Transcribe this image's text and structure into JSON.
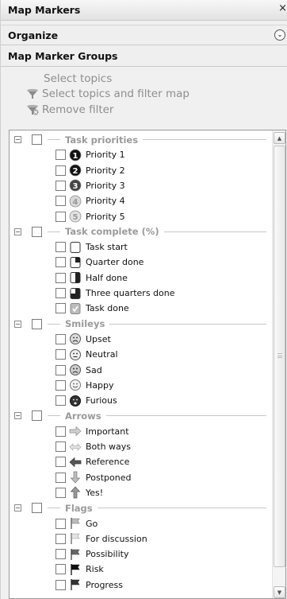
{
  "header": {
    "title": "Map Markers",
    "close_glyph": "×"
  },
  "organize": {
    "label": "Organize",
    "chevron_glyph": "⌄"
  },
  "groups_header": {
    "label": "Map Marker Groups"
  },
  "actions": {
    "select_topics": "Select topics",
    "select_and_filter": "Select topics and filter map",
    "remove_filter": "Remove filter"
  },
  "groups": [
    {
      "label": "Task priorities",
      "items": [
        {
          "label": "Priority 1",
          "icon": "priority-1",
          "glyph": "1"
        },
        {
          "label": "Priority 2",
          "icon": "priority-2",
          "glyph": "2"
        },
        {
          "label": "Priority 3",
          "icon": "priority-3",
          "glyph": "3"
        },
        {
          "label": "Priority 4",
          "icon": "priority-4",
          "glyph": "4"
        },
        {
          "label": "Priority 5",
          "icon": "priority-5",
          "glyph": "5"
        }
      ]
    },
    {
      "label": "Task complete (%)",
      "items": [
        {
          "label": "Task start",
          "icon": "task-start"
        },
        {
          "label": "Quarter done",
          "icon": "quarter-done"
        },
        {
          "label": "Half done",
          "icon": "half-done"
        },
        {
          "label": "Three quarters done",
          "icon": "three-quarters-done"
        },
        {
          "label": "Task done",
          "icon": "task-done"
        }
      ]
    },
    {
      "label": "Smileys",
      "items": [
        {
          "label": "Upset",
          "icon": "upset"
        },
        {
          "label": "Neutral",
          "icon": "neutral"
        },
        {
          "label": "Sad",
          "icon": "sad"
        },
        {
          "label": "Happy",
          "icon": "happy"
        },
        {
          "label": "Furious",
          "icon": "furious"
        }
      ]
    },
    {
      "label": "Arrows",
      "items": [
        {
          "label": "Important",
          "icon": "arrow-right"
        },
        {
          "label": "Both ways",
          "icon": "arrow-both"
        },
        {
          "label": "Reference",
          "icon": "arrow-left"
        },
        {
          "label": "Postponed",
          "icon": "arrow-down"
        },
        {
          "label": "Yes!",
          "icon": "arrow-up"
        }
      ]
    },
    {
      "label": "Flags",
      "items": [
        {
          "label": "Go",
          "icon": "flag-go"
        },
        {
          "label": "For discussion",
          "icon": "flag-discussion"
        },
        {
          "label": "Possibility",
          "icon": "flag-possibility"
        },
        {
          "label": "Risk",
          "icon": "flag-risk"
        },
        {
          "label": "Progress",
          "icon": "flag-progress"
        }
      ]
    }
  ],
  "expander_glyph": "−",
  "scroll_glyphs": {
    "up": "▲",
    "down": "▼"
  }
}
